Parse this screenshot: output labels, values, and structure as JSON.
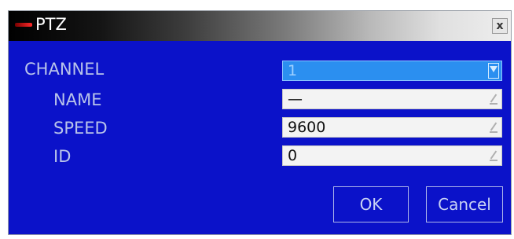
{
  "window": {
    "title": "PTZ",
    "close_glyph": "x"
  },
  "fields": {
    "channel": {
      "label": "CHANNEL",
      "value": "1"
    },
    "name": {
      "label": "NAME",
      "value": "—"
    },
    "speed": {
      "label": "SPEED",
      "value": "9600"
    },
    "id": {
      "label": "ID",
      "value": "0"
    }
  },
  "buttons": {
    "ok": "OK",
    "cancel": "Cancel"
  },
  "icons": {
    "app": "app-logo-icon",
    "close": "close-icon",
    "dropdown": "chevron-down-icon",
    "edit": "edit-icon"
  },
  "colors": {
    "dialog_bg": "#0b12c9",
    "label_text": "#b9c4ea",
    "select_bg": "#2b8ff0",
    "field_bg": "#f3f3f3"
  }
}
